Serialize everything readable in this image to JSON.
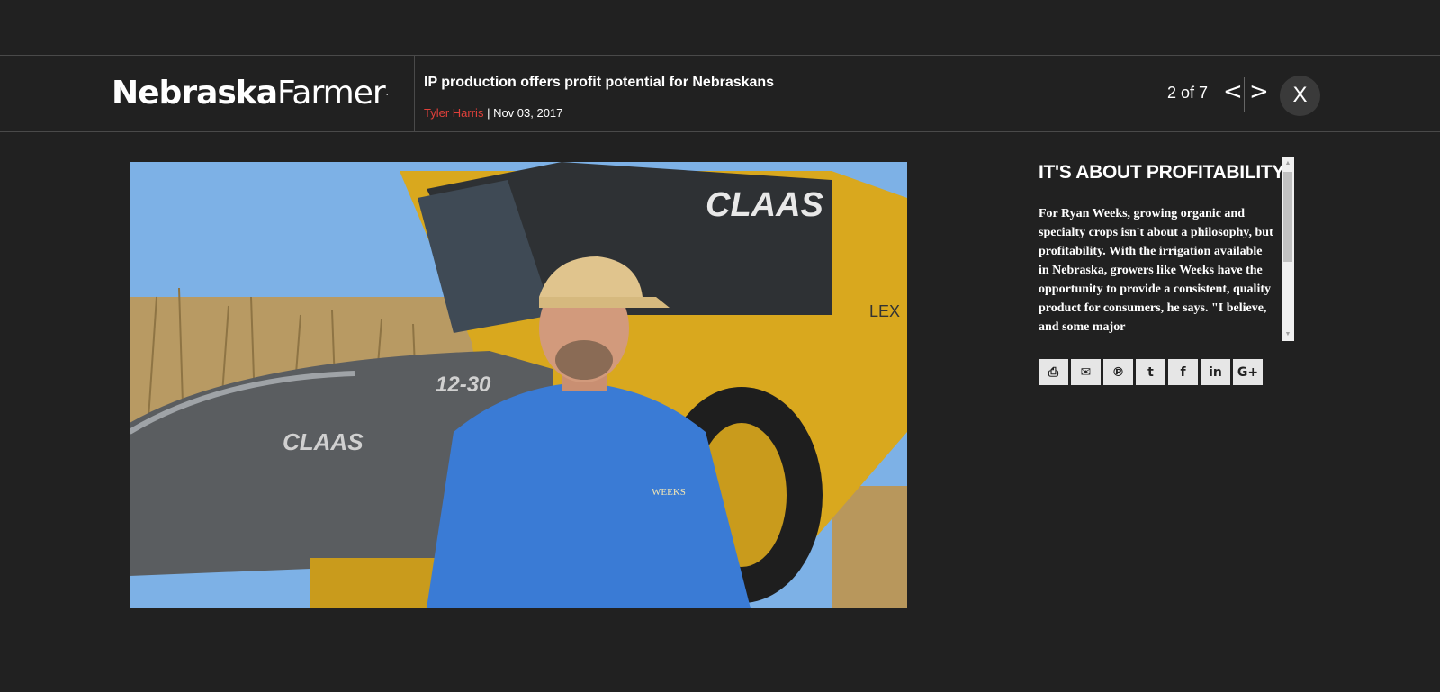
{
  "brand": {
    "logo_bold": "Nebraska",
    "logo_light": "Farmer",
    "logo_mark": "."
  },
  "article": {
    "title": "IP production offers profit potential for Nebraskans",
    "author": "Tyler Harris",
    "separator": " | ",
    "date": "Nov 03, 2017"
  },
  "gallery": {
    "counter": "2 of 7",
    "prev_label": "<",
    "next_label": ">",
    "close_label": "X"
  },
  "caption": {
    "heading": "IT'S ABOUT PROFITABILITY",
    "text": "For Ryan Weeks, growing organic and specialty crops isn't about a philosophy, but profitability. With the irrigation available in Nebraska, growers like Weeks have the opportunity to provide a consistent, quality product for consumers, he says. \"I believe, and some major"
  },
  "photo": {
    "combine_brand": "CLAAS",
    "header_model": "12-30",
    "model_text": "LEX",
    "shirt_logo": "WEEKS"
  },
  "share": [
    {
      "name": "print-icon",
      "glyph": "⎙"
    },
    {
      "name": "email-icon",
      "glyph": "✉"
    },
    {
      "name": "pinterest-icon",
      "glyph": "℗"
    },
    {
      "name": "twitter-icon",
      "glyph": "t"
    },
    {
      "name": "facebook-icon",
      "glyph": "f"
    },
    {
      "name": "linkedin-icon",
      "glyph": "in"
    },
    {
      "name": "googleplus-icon",
      "glyph": "G+"
    }
  ],
  "colors": {
    "background": "#212121",
    "author": "#e0403a",
    "combine_yellow": "#d9a81e"
  }
}
